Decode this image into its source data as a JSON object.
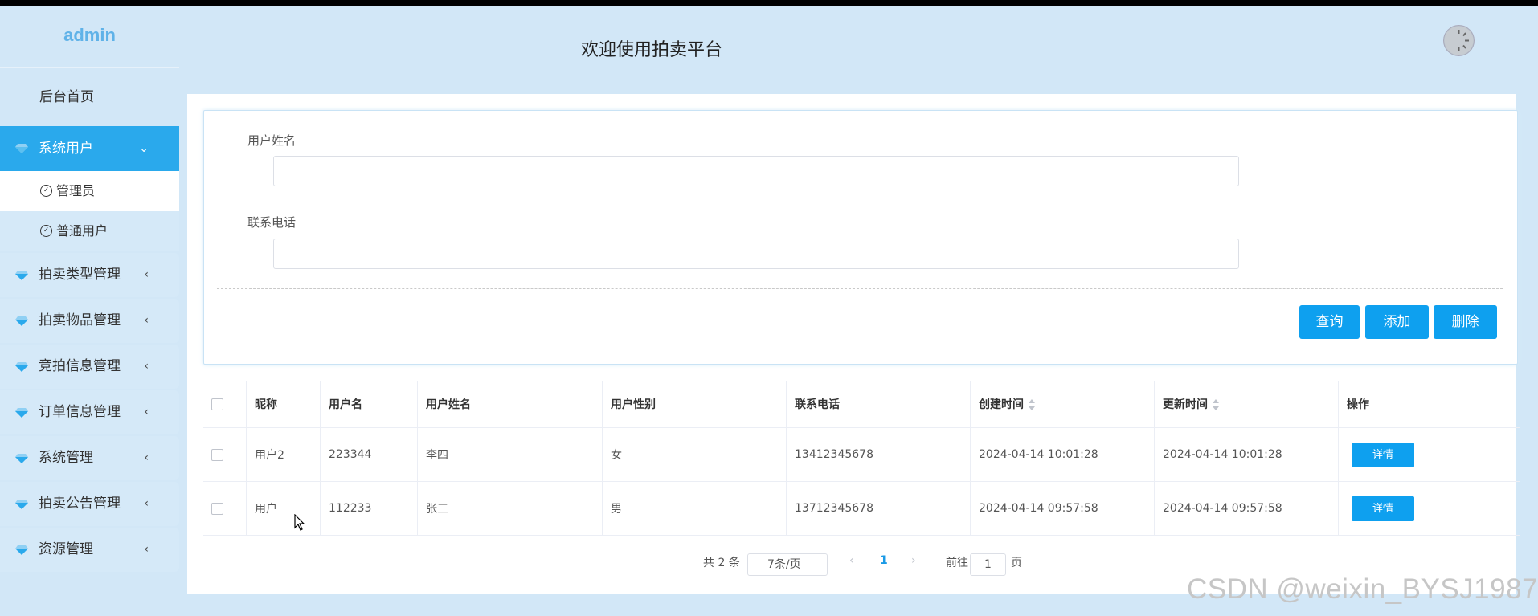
{
  "app": {
    "logo": "admin",
    "header_title": "欢迎使用拍卖平台"
  },
  "sidebar": {
    "home": "后台首页",
    "items": [
      {
        "label": "系统用户",
        "icon": "gem-icon",
        "expanded": true
      },
      {
        "label": "拍卖类型管理",
        "icon": "gem-icon"
      },
      {
        "label": "拍卖物品管理",
        "icon": "gem-icon"
      },
      {
        "label": "竞拍信息管理",
        "icon": "gem-icon"
      },
      {
        "label": "订单信息管理",
        "icon": "gem-icon"
      },
      {
        "label": "系统管理",
        "icon": "gem-icon"
      },
      {
        "label": "拍卖公告管理",
        "icon": "gem-icon"
      },
      {
        "label": "资源管理",
        "icon": "gem-icon"
      }
    ],
    "sub_items": [
      {
        "label": "管理员"
      },
      {
        "label": "普通用户"
      }
    ]
  },
  "search": {
    "name_label": "用户姓名",
    "name_value": "",
    "phone_label": "联系电话",
    "phone_value": "",
    "query_btn": "查询",
    "add_btn": "添加",
    "delete_btn": "删除"
  },
  "table": {
    "columns": [
      "昵称",
      "用户名",
      "用户姓名",
      "用户性别",
      "联系电话",
      "创建时间",
      "更新时间",
      "操作"
    ],
    "rows": [
      {
        "nickname": "用户2",
        "username": "223344",
        "realname": "李四",
        "gender": "女",
        "phone": "13412345678",
        "created": "2024-04-14 10:01:28",
        "updated": "2024-04-14 10:01:28",
        "action": "详情"
      },
      {
        "nickname": "用户",
        "username": "112233",
        "realname": "张三",
        "gender": "男",
        "phone": "13712345678",
        "created": "2024-04-14 09:57:58",
        "updated": "2024-04-14 09:57:58",
        "action": "详情"
      }
    ]
  },
  "pagination": {
    "total": "共 2 条",
    "page_size": "7条/页",
    "current_page": "1",
    "goto_label": "前往",
    "goto_value": "1",
    "page_unit": "页"
  },
  "watermark": "CSDN @weixin_BYSJ1987",
  "colors": {
    "accent": "#0ea0ef",
    "sidebar_bg": "#d2e7f7",
    "active_item": "#2aa9ec",
    "logo": "#5fb2e8"
  }
}
